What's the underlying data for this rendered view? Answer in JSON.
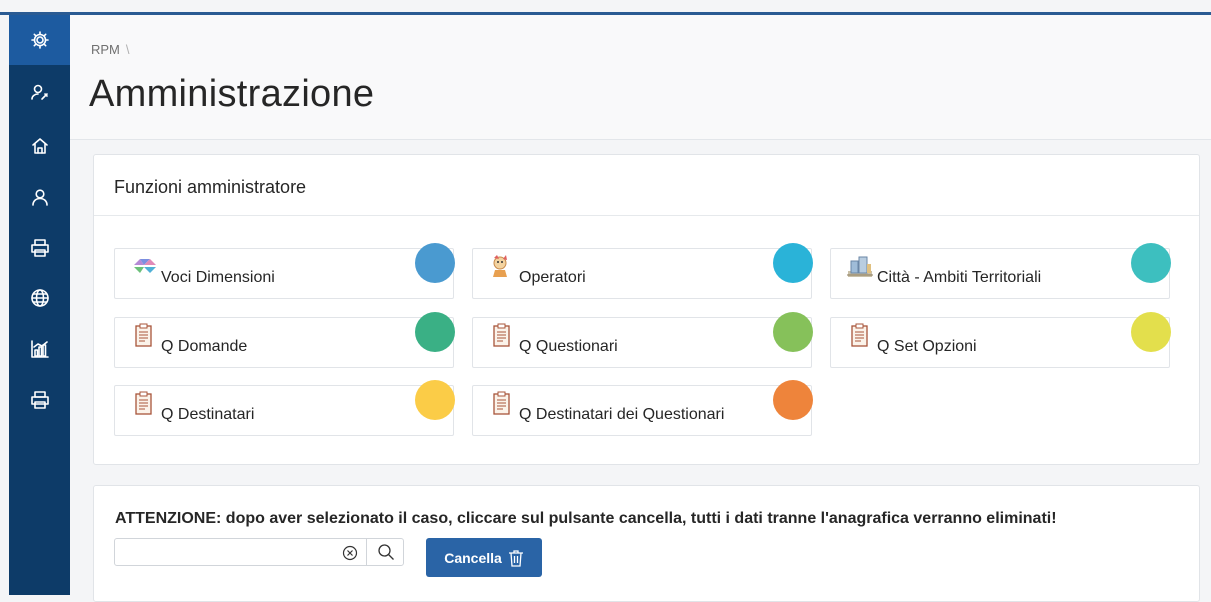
{
  "sidebar": {
    "items": [
      {
        "icon": "gear-icon",
        "active": true
      },
      {
        "icon": "user-wrench-icon",
        "active": false
      },
      {
        "icon": "home-icon",
        "active": false
      },
      {
        "icon": "user-icon",
        "active": false
      },
      {
        "icon": "printer-icon",
        "active": false
      },
      {
        "icon": "globe-icon",
        "active": false
      },
      {
        "icon": "bar-chart-icon",
        "active": false
      },
      {
        "icon": "printer-icon",
        "active": false
      }
    ]
  },
  "header": {
    "breadcrumb": "RPM",
    "breadcrumb_sep": "\\",
    "title": "Amministrazione"
  },
  "admin": {
    "region_title": "Funzioni amministratore",
    "cards": [
      {
        "label": "Voci Dimensioni",
        "icon": "dimensions-icon",
        "color": "#4a9ad0"
      },
      {
        "label": "Operatori",
        "icon": "operators-icon",
        "color": "#2ab3d8"
      },
      {
        "label": "Città - Ambiti Territoriali",
        "icon": "city-icon",
        "color": "#3dbfbf"
      },
      {
        "label": "Q Domande",
        "icon": "clipboard-icon",
        "color": "#3ab085"
      },
      {
        "label": "Q Questionari",
        "icon": "clipboard-icon",
        "color": "#86c15a"
      },
      {
        "label": "Q Set Opzioni",
        "icon": "clipboard-icon",
        "color": "#e3df4c"
      },
      {
        "label": "Q Destinatari",
        "icon": "clipboard-icon",
        "color": "#fbcc47"
      },
      {
        "label": "Q Destinatari dei Questionari",
        "icon": "clipboard-icon",
        "color": "#ee843b"
      }
    ]
  },
  "delete_section": {
    "warning": "ATTENZIONE: dopo aver selezionato il caso, cliccare sul pulsante cancella, tutti i dati tranne l'anagrafica verranno eliminati!",
    "input_value": "",
    "button_label": "Cancella",
    "button_color": "#2a64a6"
  }
}
